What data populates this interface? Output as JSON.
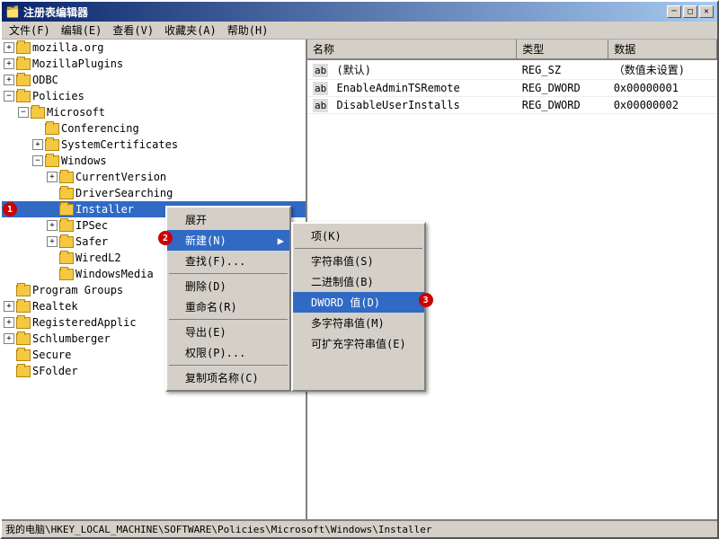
{
  "window": {
    "title": "注册表编辑器",
    "titlebar_icon": "📋"
  },
  "titlebar_buttons": {
    "minimize": "─",
    "maximize": "□",
    "close": "✕"
  },
  "menubar": {
    "items": [
      {
        "label": "文件(F)",
        "id": "file"
      },
      {
        "label": "编辑(E)",
        "id": "edit"
      },
      {
        "label": "查看(V)",
        "id": "view"
      },
      {
        "label": "收藏夹(A)",
        "id": "favorites"
      },
      {
        "label": "帮助(H)",
        "id": "help"
      }
    ]
  },
  "tree": {
    "items": [
      {
        "id": "mozilla",
        "label": "mozilla.org",
        "depth": 1,
        "expanded": true,
        "has_children": true
      },
      {
        "id": "mozillaplugins",
        "label": "MozillaPlugins",
        "depth": 1,
        "expanded": false,
        "has_children": true
      },
      {
        "id": "odbc",
        "label": "ODBC",
        "depth": 1,
        "expanded": false,
        "has_children": true
      },
      {
        "id": "policies",
        "label": "Policies",
        "depth": 1,
        "expanded": true,
        "has_children": true
      },
      {
        "id": "microsoft",
        "label": "Microsoft",
        "depth": 2,
        "expanded": true,
        "has_children": true
      },
      {
        "id": "conferencing",
        "label": "Conferencing",
        "depth": 3,
        "expanded": false,
        "has_children": false
      },
      {
        "id": "systemcerts",
        "label": "SystemCertificates",
        "depth": 3,
        "expanded": false,
        "has_children": true
      },
      {
        "id": "windows",
        "label": "Windows",
        "depth": 3,
        "expanded": true,
        "has_children": true
      },
      {
        "id": "currentversion",
        "label": "CurrentVersion",
        "depth": 4,
        "expanded": false,
        "has_children": true
      },
      {
        "id": "driversearching",
        "label": "DriverSearching",
        "depth": 4,
        "expanded": false,
        "has_children": false
      },
      {
        "id": "installer",
        "label": "Installer",
        "depth": 4,
        "expanded": false,
        "has_children": false,
        "selected": true
      },
      {
        "id": "ipsec",
        "label": "IPSec",
        "depth": 4,
        "expanded": false,
        "has_children": true
      },
      {
        "id": "safer",
        "label": "Safer",
        "depth": 4,
        "expanded": false,
        "has_children": true
      },
      {
        "id": "wiredl2",
        "label": "WiredL2",
        "depth": 4,
        "expanded": false,
        "has_children": false
      },
      {
        "id": "windowsmedia",
        "label": "WindowsMedia",
        "depth": 4,
        "expanded": false,
        "has_children": false
      },
      {
        "id": "programgroups",
        "label": "Program Groups",
        "depth": 1,
        "expanded": false,
        "has_children": false
      },
      {
        "id": "realtek",
        "label": "Realtek",
        "depth": 1,
        "expanded": false,
        "has_children": true
      },
      {
        "id": "registeredapplic",
        "label": "RegisteredApplic",
        "depth": 1,
        "expanded": false,
        "has_children": true
      },
      {
        "id": "schlumberger",
        "label": "Schlumberger",
        "depth": 1,
        "expanded": false,
        "has_children": true
      },
      {
        "id": "secure",
        "label": "Secure",
        "depth": 1,
        "expanded": false,
        "has_children": false
      },
      {
        "id": "sfolder",
        "label": "SFolder",
        "depth": 1,
        "expanded": false,
        "has_children": false
      }
    ]
  },
  "registry_table": {
    "columns": [
      "名称",
      "类型",
      "数据"
    ],
    "rows": [
      {
        "name": "(默认)",
        "type": "REG_SZ",
        "data": "（数值未设置)",
        "icon": "ab"
      },
      {
        "name": "EnableAdminTSRemote",
        "type": "REG_DWORD",
        "data": "0x00000001",
        "icon": "ab"
      },
      {
        "name": "DisableUserInstalls",
        "type": "REG_DWORD",
        "data": "0x00000002",
        "icon": "ab"
      }
    ]
  },
  "context_menu": {
    "items": [
      {
        "label": "展开",
        "id": "expand",
        "disabled": false
      },
      {
        "label": "新建(N)",
        "id": "new",
        "disabled": false,
        "has_submenu": true,
        "highlighted": true
      },
      {
        "label": "查找(F)...",
        "id": "find",
        "disabled": false
      },
      {
        "separator": true
      },
      {
        "label": "删除(D)",
        "id": "delete",
        "disabled": false
      },
      {
        "label": "重命名(R)",
        "id": "rename",
        "disabled": false
      },
      {
        "separator": true
      },
      {
        "label": "导出(E)",
        "id": "export",
        "disabled": false
      },
      {
        "label": "权限(P)...",
        "id": "permissions",
        "disabled": false
      },
      {
        "separator": true
      },
      {
        "label": "复制项名称(C)",
        "id": "copy_name",
        "disabled": false
      }
    ],
    "submenu": {
      "items": [
        {
          "label": "项(K)",
          "id": "key"
        },
        {
          "separator": true
        },
        {
          "label": "字符串值(S)",
          "id": "string"
        },
        {
          "label": "二进制值(B)",
          "id": "binary"
        },
        {
          "label": "DWORD 值(D)",
          "id": "dword",
          "highlighted": true
        },
        {
          "label": "多字符串值(M)",
          "id": "multistring"
        },
        {
          "label": "可扩充字符串值(E)",
          "id": "expandstring"
        }
      ]
    }
  },
  "statusbar": {
    "text": "我的电脑\\HKEY_LOCAL_MACHINE\\SOFTWARE\\Policies\\Microsoft\\Windows\\Installer"
  },
  "badges": {
    "one": "1",
    "two": "2",
    "three": "3"
  }
}
